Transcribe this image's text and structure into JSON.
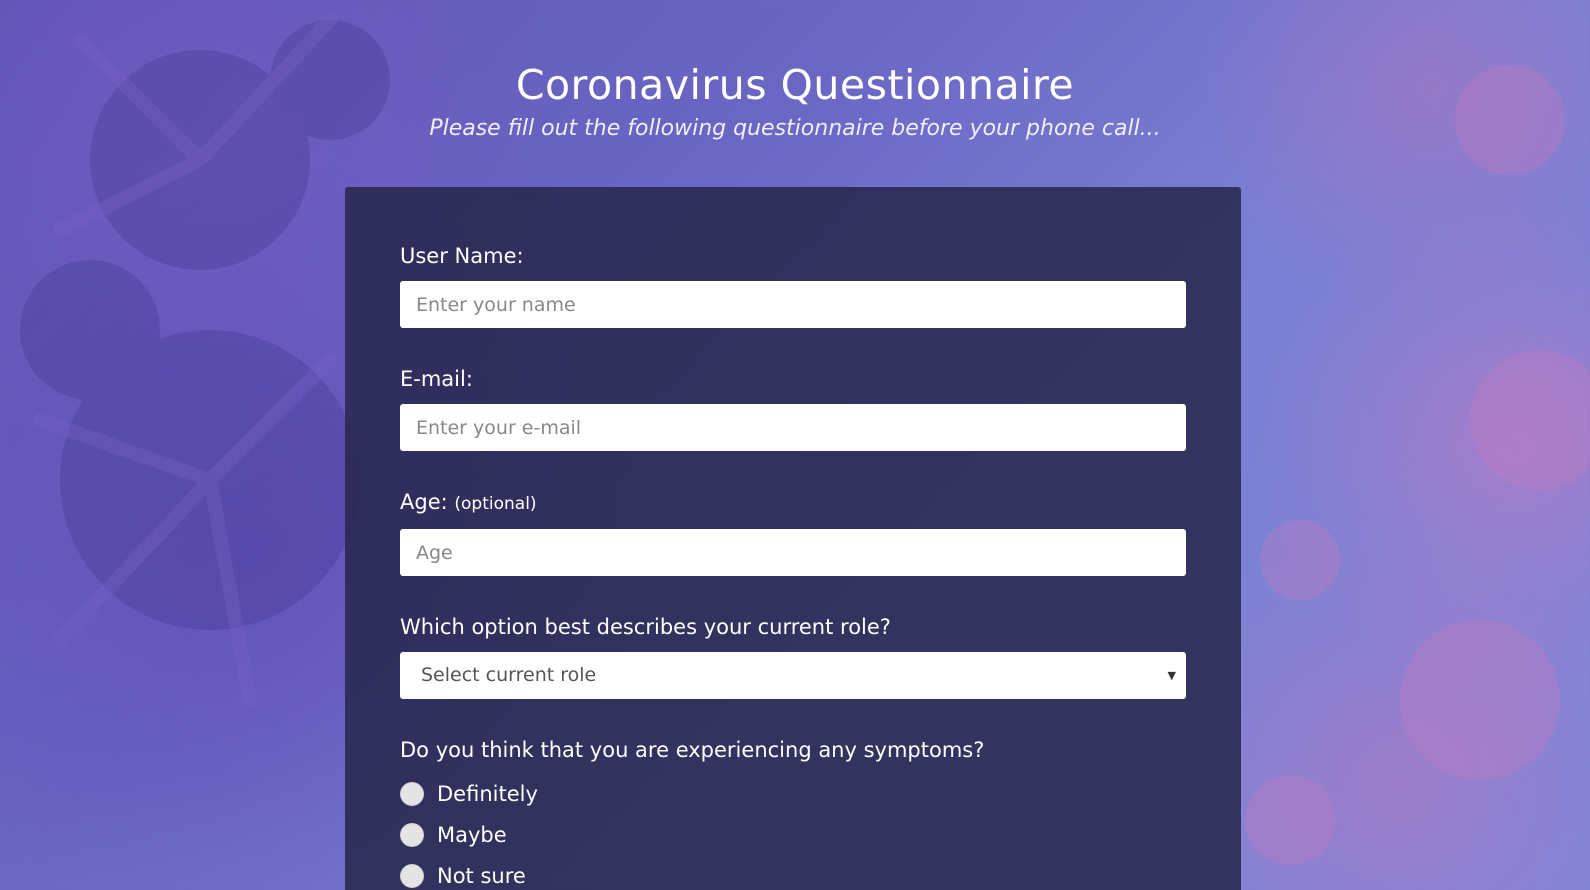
{
  "header": {
    "title": "Coronavirus Questionnaire",
    "subtitle": "Please fill out the following questionnaire before your phone call..."
  },
  "form": {
    "username": {
      "label": "User Name:",
      "placeholder": "Enter your name"
    },
    "email": {
      "label": "E-mail:",
      "placeholder": "Enter your e-mail"
    },
    "age": {
      "label": "Age:",
      "optional_note": "(optional)",
      "placeholder": "Age"
    },
    "role": {
      "label": "Which option best describes your current role?",
      "selected": "Select current role"
    },
    "symptoms": {
      "question": "Do you think that you are experiencing any symptoms?",
      "options": [
        "Definitely",
        "Maybe",
        "Not sure"
      ]
    }
  },
  "icons": {
    "select_arrow": "chevron-down-icon"
  },
  "colors": {
    "card_background": "#26264c",
    "background_accent": "#6a66c4"
  }
}
